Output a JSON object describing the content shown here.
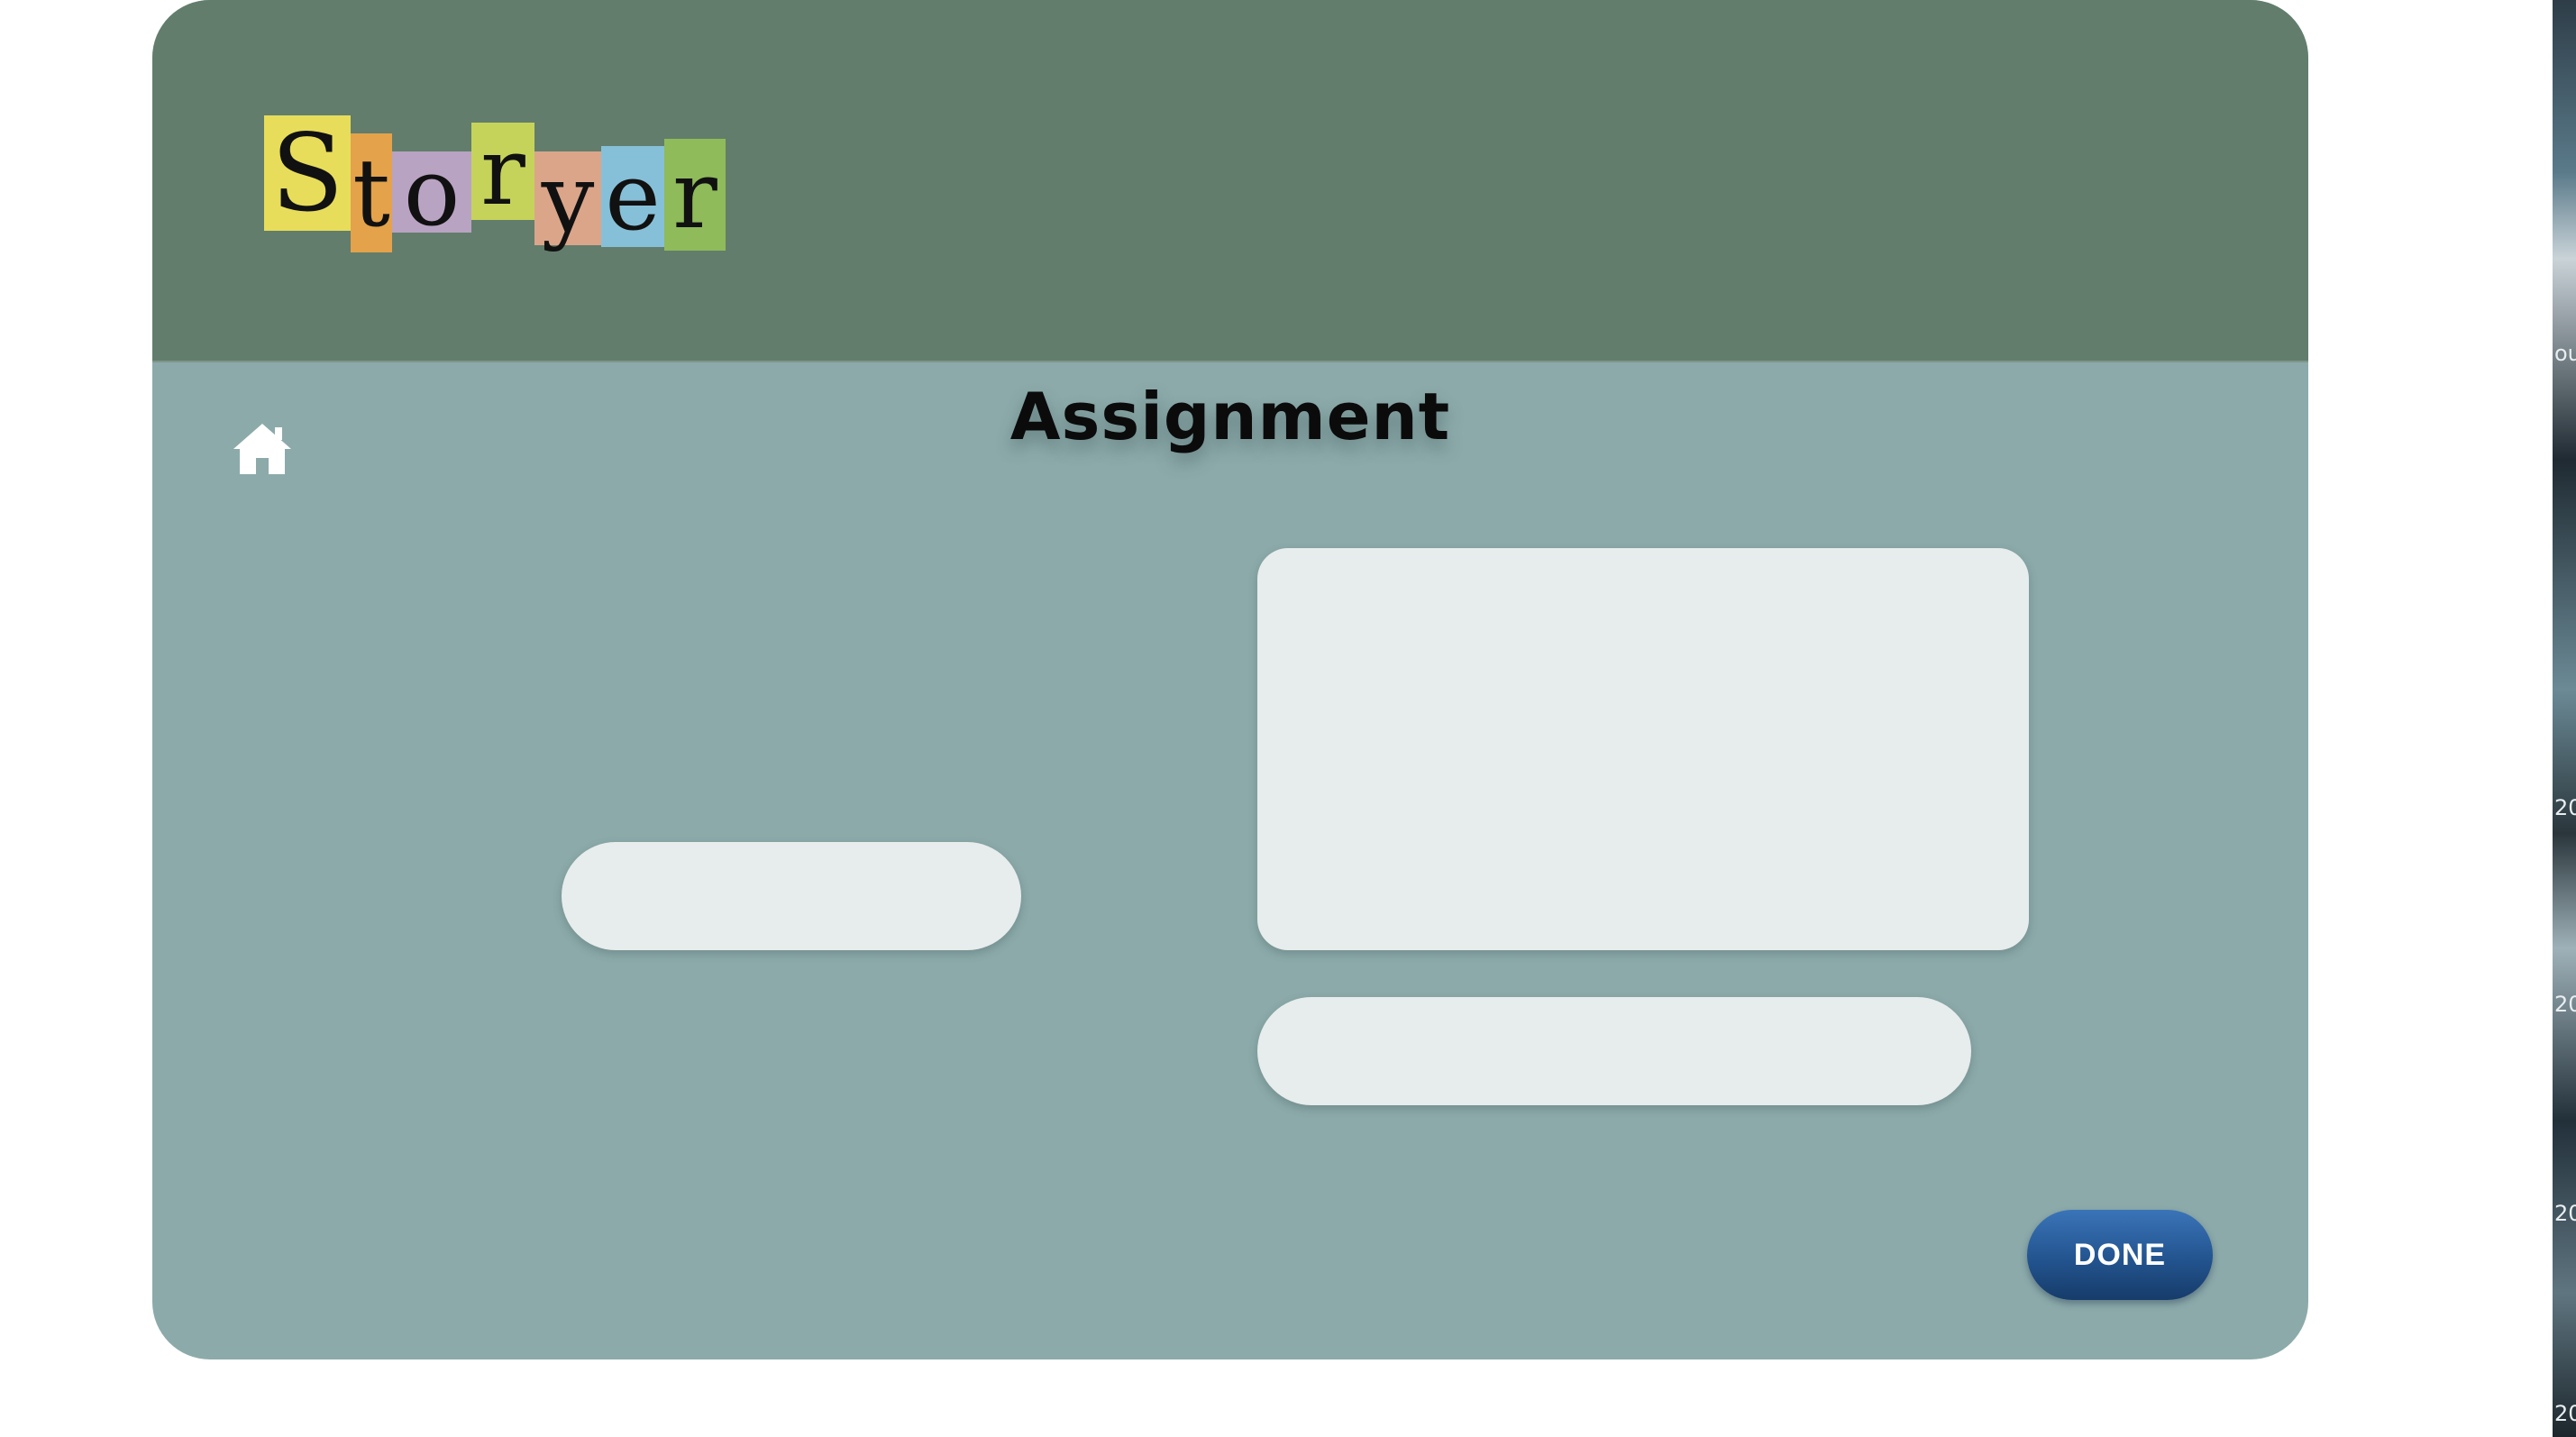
{
  "app": {
    "logo_text": "Storyer",
    "logo_letters": [
      "S",
      "t",
      "o",
      "r",
      "y",
      "e",
      "r"
    ],
    "logo_colors": [
      "#e7dd5a",
      "#e4a24a",
      "#b9a3c3",
      "#c6d35a",
      "#dba58a",
      "#86c0d8",
      "#8fbb5a"
    ]
  },
  "header": {
    "background": "#627d6c"
  },
  "main": {
    "title": "Assignment",
    "background": "#8caaaa",
    "home_icon": "home-icon",
    "fields": {
      "left_input": {
        "value": "",
        "placeholder": ""
      },
      "text_area": {
        "value": "",
        "placeholder": ""
      },
      "bottom_input": {
        "value": "",
        "placeholder": ""
      }
    },
    "done_label": "DONE",
    "done_color": "#23548f"
  },
  "desktop": {
    "edge_labels": [
      "ou",
      "20",
      "20",
      "20",
      "20"
    ]
  }
}
